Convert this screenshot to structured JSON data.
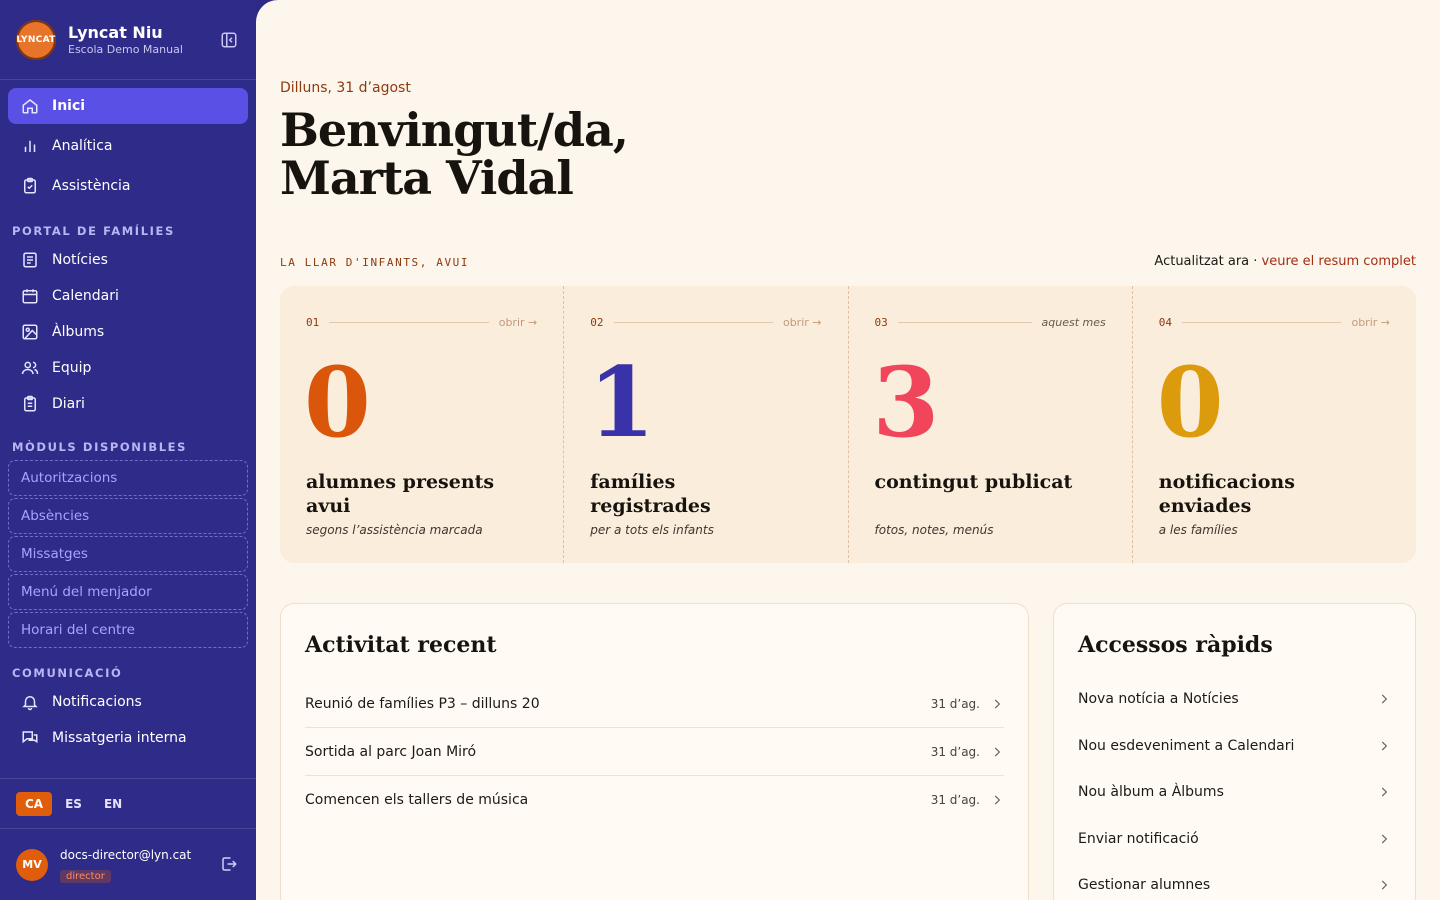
{
  "brand": {
    "title": "Lyncat Niu",
    "subtitle": "Escola Demo Manual",
    "logo_text": "LYNCAT"
  },
  "nav_main": [
    {
      "label": "Inici",
      "icon": "home-icon",
      "active": true
    },
    {
      "label": "Analítica",
      "icon": "bar-chart-icon"
    },
    {
      "label": "Assistència",
      "icon": "clipboard-check-icon"
    }
  ],
  "sections": {
    "families": "PORTAL DE FAMÍLIES",
    "modules": "MÒDULS DISPONIBLES",
    "communication": "COMUNICACIÓ"
  },
  "nav_families": [
    {
      "label": "Notícies",
      "icon": "newspaper-icon"
    },
    {
      "label": "Calendari",
      "icon": "calendar-icon"
    },
    {
      "label": "Àlbums",
      "icon": "image-icon"
    },
    {
      "label": "Equip",
      "icon": "users-icon"
    },
    {
      "label": "Diari",
      "icon": "journal-icon"
    }
  ],
  "modules": [
    "Autoritzacions",
    "Absències",
    "Missatges",
    "Menú del menjador",
    "Horari del centre"
  ],
  "nav_communication": [
    {
      "label": "Notificacions",
      "icon": "bell-icon"
    },
    {
      "label": "Missatgeria interna",
      "icon": "chat-icon"
    }
  ],
  "languages": [
    "CA",
    "ES",
    "EN"
  ],
  "user": {
    "initials": "MV",
    "email": "docs-director@lyn.cat",
    "role": "director"
  },
  "header": {
    "date": "Dilluns, 31 d’agost",
    "welcome_line1": "Benvingut/da,",
    "welcome_line2": "Marta Vidal"
  },
  "today": {
    "label": "LA LLAR D'INFANTS, AVUI",
    "updated": "Actualitzat ara · ",
    "summary_link": "veure el resum complet"
  },
  "stats": [
    {
      "num": "01",
      "link": "obrir →",
      "value": "0",
      "title": "alumnes presents avui",
      "sub": "segons l’assistència marcada",
      "color": "#d9560b"
    },
    {
      "num": "02",
      "link": "obrir →",
      "value": "1",
      "title": "famílies registrades",
      "sub": "per a tots els infants",
      "color": "#3a32a8"
    },
    {
      "num": "03",
      "link": "aquest mes",
      "value": "3",
      "title": "contingut publicat",
      "sub": "fotos, notes, menús",
      "color": "#f0455a"
    },
    {
      "num": "04",
      "link": "obrir →",
      "value": "0",
      "title": "notificacions enviades",
      "sub": "a les famílies",
      "color": "#dc9a0d"
    }
  ],
  "recent": {
    "title": "Activitat recent",
    "items": [
      {
        "text": "Reunió de famílies P3 – dilluns 20",
        "date": "31 d’ag."
      },
      {
        "text": "Sortida al parc Joan Miró",
        "date": "31 d’ag."
      },
      {
        "text": "Comencen els tallers de música",
        "date": "31 d’ag."
      }
    ]
  },
  "quick": {
    "title": "Accessos ràpids",
    "items": [
      "Nova notícia a Notícies",
      "Nou esdeveniment a Calendari",
      "Nou àlbum a Àlbums",
      "Enviar notificació",
      "Gestionar alumnes"
    ]
  }
}
